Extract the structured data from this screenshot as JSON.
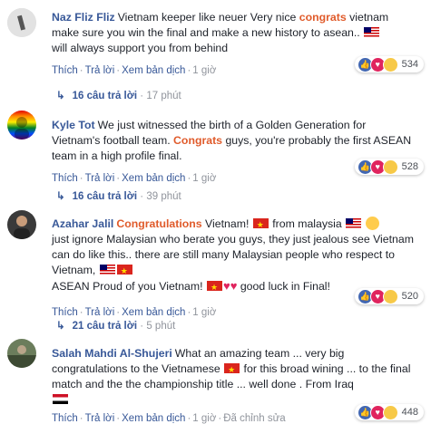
{
  "comments": [
    {
      "name": "Naz Fliz Fliz",
      "text_1": "Vietnam keeper like neuer Very nice ",
      "highlight": "congrats",
      "text_2": " vietnam make sure you win the final and make a new history to asean..",
      "text_3": " will always support you from behind",
      "actions": {
        "like": "Thích",
        "reply": "Trả lời",
        "translate": "Xem bản dịch",
        "time": "1 giờ"
      },
      "reaction_count": "534",
      "replies": {
        "label": "16 câu trả lời",
        "time": "17 phút"
      }
    },
    {
      "name": "Kyle Tot",
      "text_1": "We just witnessed the birth of a Golden Generation for Vietnam's football team. ",
      "highlight": "Congrats",
      "text_2": " guys, you're probably the first ASEAN team in a high profile final.",
      "actions": {
        "like": "Thích",
        "reply": "Trả lời",
        "translate": "Xem bản dịch",
        "time": "1 giờ"
      },
      "reaction_count": "528",
      "replies": {
        "label": "16 câu trả lời",
        "time": "39 phút"
      }
    },
    {
      "name": "Azahar Jalil",
      "highlight": "Congratulations",
      "text_1": " Vietnam!",
      "text_2": " from malaysia",
      "text_3": " just ignore Malaysian who berate you guys, they just jealous see Vietnam can do like this.. there are still many Malaysian people who respect to Vietnam,",
      "text_4": "ASEAN Proud of you Vietnam!",
      "text_5": " good luck in Final!",
      "actions": {
        "like": "Thích",
        "reply": "Trả lời",
        "translate": "Xem bản dịch",
        "time": "1 giờ"
      },
      "reaction_count": "520",
      "replies": {
        "label": "21 câu trả lời",
        "time": "5 phút"
      }
    },
    {
      "name": "Salah Mahdi Al-Shujeri",
      "text_1": "What an amazing team ... very big congratulations to the Vietnamese",
      "text_2": " for this broad wining ... to the final match and the the championship title ... well done . From Iraq",
      "actions": {
        "like": "Thích",
        "reply": "Trả lời",
        "translate": "Xem bản dịch",
        "time": "1 giờ",
        "edited": "Đã chỉnh sửa"
      },
      "reaction_count": "448"
    }
  ],
  "colors": {
    "link": "#385898",
    "highlight": "#e05b2b",
    "like": "#4267b2",
    "love": "#e0245e",
    "haha": "#f7c948"
  },
  "icons": [
    "reply-arrow-icon",
    "like-reaction-icon",
    "love-reaction-icon",
    "haha-reaction-icon",
    "vietnam-flag-icon",
    "malaysia-flag-icon",
    "iraq-flag-icon",
    "smile-emoji-icon",
    "heart-icon"
  ]
}
